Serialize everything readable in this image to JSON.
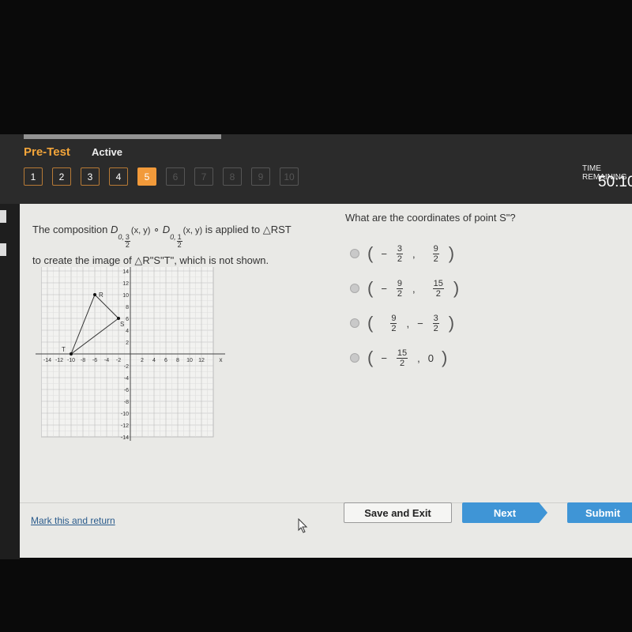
{
  "header": {
    "section": "Pre-Test",
    "status": "Active",
    "time_label": "TIME REMAINING",
    "time": "50:10",
    "questions": [
      "1",
      "2",
      "3",
      "4",
      "5",
      "6",
      "7",
      "8",
      "9",
      "10"
    ],
    "current": 5,
    "answered_through": 4
  },
  "prompt": {
    "t1": "The composition ",
    "D": "D",
    "sub1": "0,",
    "f1n": "3",
    "f1d": "2",
    "xy1": "(x, y)",
    "op": " ∘ ",
    "sub2": "0,",
    "f2n": "1",
    "f2d": "2",
    "xy2": "(x, y)",
    "t2": " is applied to △RST",
    "line2": "to create the image of △R\"S\"T\", which is not shown."
  },
  "question": "What are the coordinates of point S\"?",
  "choices": [
    {
      "a_sign": "−",
      "a_num": "3",
      "a_den": "2",
      "b_sign": "",
      "b_num": "9",
      "b_den": "2"
    },
    {
      "a_sign": "−",
      "a_num": "9",
      "a_den": "2",
      "b_sign": "",
      "b_num": "15",
      "b_den": "2"
    },
    {
      "a_sign": "",
      "a_num": "9",
      "a_den": "2",
      "b_sign": "−",
      "b_num": "3",
      "b_den": "2"
    },
    {
      "a_sign": "−",
      "a_num": "15",
      "a_den": "2",
      "b_value": "0"
    }
  ],
  "graph": {
    "x_label": "x",
    "y_label": "y",
    "x_ticks": [
      -14,
      -12,
      -10,
      -8,
      -6,
      -4,
      -2,
      2,
      4,
      6,
      8,
      10,
      12
    ],
    "y_ticks": [
      14,
      12,
      10,
      8,
      6,
      4,
      2,
      -2,
      -4,
      -6,
      -8,
      -10,
      -12,
      -14
    ],
    "points": [
      {
        "label": "R",
        "x": -6,
        "y": 10
      },
      {
        "label": "S",
        "x": -2,
        "y": 6
      },
      {
        "label": "T",
        "x": -10,
        "y": 0
      }
    ]
  },
  "footer": {
    "mark": "Mark this and return",
    "save": "Save and Exit",
    "next": "Next",
    "submit": "Submit"
  },
  "colors": {
    "accent": "#f29a3a",
    "button": "#3f95d6"
  }
}
